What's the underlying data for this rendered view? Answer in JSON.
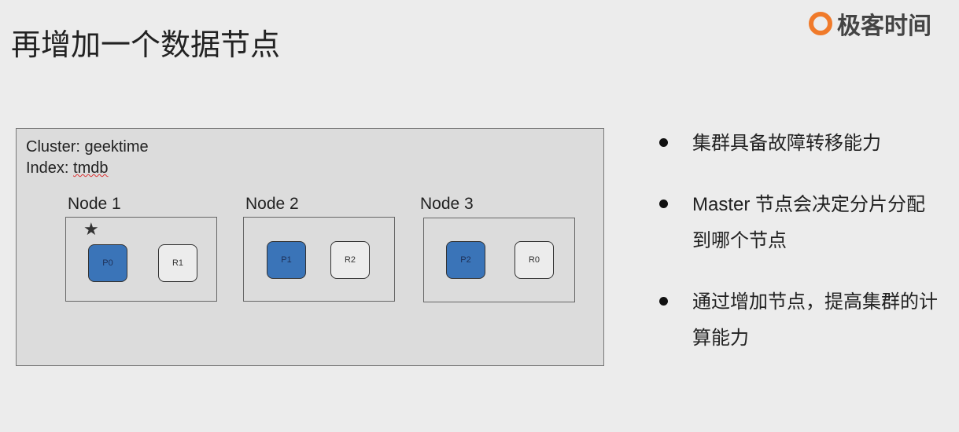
{
  "title": "再增加一个数据节点",
  "logo": {
    "text": "极客时间",
    "brand_color": "#f07a2a"
  },
  "cluster": {
    "cluster_line": "Cluster: geektime",
    "index_label": "Index: ",
    "index_value": "tmdb",
    "nodes": [
      {
        "label": "Node 1",
        "shards": [
          {
            "name": "P0",
            "type": "primary"
          },
          {
            "name": "R1",
            "type": "replica"
          }
        ],
        "master_star": "★"
      },
      {
        "label": "Node 2",
        "shards": [
          {
            "name": "P1",
            "type": "primary"
          },
          {
            "name": "R2",
            "type": "replica"
          }
        ]
      },
      {
        "label": "Node 3",
        "shards": [
          {
            "name": "P2",
            "type": "primary"
          },
          {
            "name": "R0",
            "type": "replica"
          }
        ]
      }
    ]
  },
  "bullets": [
    "集群具备故障转移能力",
    "Master 节点会决定分片分配到哪个节点",
    "通过增加节点，提高集群的计算能力"
  ]
}
